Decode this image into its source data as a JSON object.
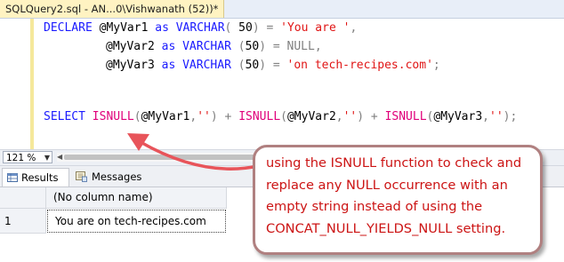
{
  "document_tab": {
    "title": "SQLQuery2.sql - AN...0\\Vishwanath (52))*"
  },
  "editor": {
    "line1": {
      "declare": "DECLARE",
      "var": "@MyVar1",
      "as": "as",
      "type": "VARCHAR",
      "paren_open": "(",
      "size": " 50",
      "paren_close": ")",
      "eq": "=",
      "value": "'You are '",
      "end": ","
    },
    "line2": {
      "var": "@MyVar2",
      "as": "as",
      "type": "VARCHAR",
      "paren_open": "(",
      "size": "50",
      "paren_close": ")",
      "eq": "=",
      "value": "NULL",
      "end": ","
    },
    "line3": {
      "var": "@MyVar3",
      "as": "as",
      "type": "VARCHAR",
      "paren_open": "(",
      "size": "50",
      "paren_close": ")",
      "eq": "=",
      "value": "'on tech-recipes.com'",
      "end": ";"
    },
    "line4": {
      "select": "SELECT",
      "fn1": "ISNULL",
      "arg1_open": "(",
      "arg1_var": "@MyVar1",
      "arg1_sep": ",",
      "arg1_str": "''",
      "arg1_close": ")",
      "plus1": "+",
      "fn2": "ISNULL",
      "arg2_open": "(",
      "arg2_var": "@MyVar2",
      "arg2_sep": ",",
      "arg2_str": "''",
      "arg2_close": ")",
      "plus2": "+",
      "fn3": "ISNULL",
      "arg3_open": "(",
      "arg3_var": "@MyVar3",
      "arg3_sep": ",",
      "arg3_str": "''",
      "arg3_close": ")",
      "end": ";"
    }
  },
  "zoom": {
    "level": "121 %"
  },
  "result_tabs": [
    {
      "label": "Results"
    },
    {
      "label": "Messages"
    }
  ],
  "results_grid": {
    "column_header": "(No column name)",
    "rows": [
      {
        "row_number": "1",
        "value": "You are on tech-recipes.com"
      }
    ]
  },
  "annotation": {
    "lines": [
      "using the ISNULL function to check and",
      "replace any NULL occurrence with an",
      "empty string instead of using the",
      "CONCAT_NULL_YIELDS_NULL setting."
    ]
  },
  "colors": {
    "keyword": "#1a1aff",
    "function": "#e0007a",
    "string": "#e01515",
    "annotation_text": "#cc1414",
    "annotation_border": "#b08080",
    "arrow": "#e8545a"
  }
}
